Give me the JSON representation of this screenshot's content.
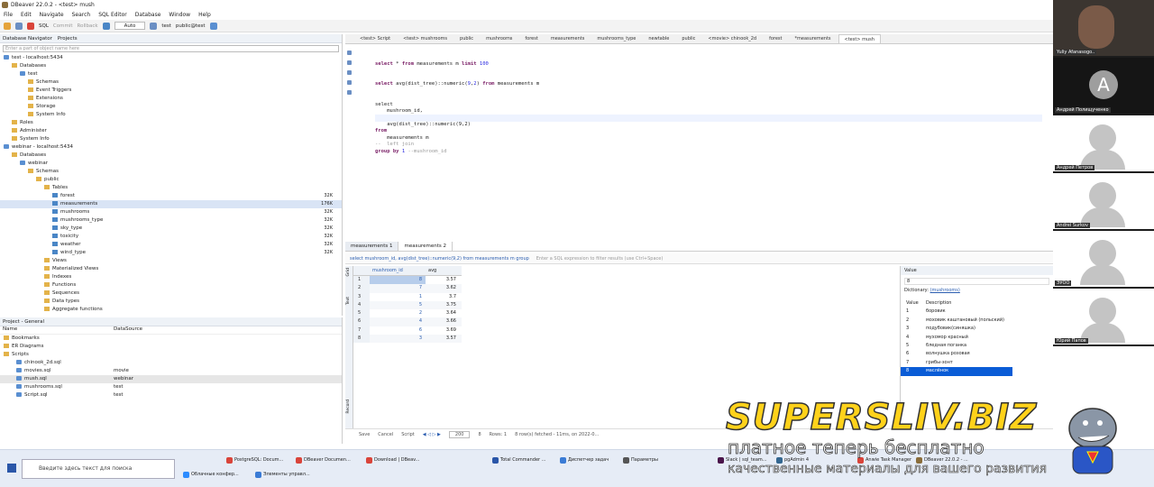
{
  "window": {
    "title": "DBeaver 22.0.2 - <test> mush"
  },
  "menu": [
    "File",
    "Edit",
    "Navigate",
    "Search",
    "SQL Editor",
    "Database",
    "Window",
    "Help"
  ],
  "toolbar": {
    "sql": "SQL",
    "commit": "Commit",
    "rollback": "Rollback",
    "mode": "Auto",
    "connection": "test",
    "schema": "public@test"
  },
  "navigator": {
    "tab1": "Database Navigator",
    "tab2": "Projects",
    "filter_placeholder": "Enter a part of object name here",
    "rows": [
      {
        "label": "test - localhost:5434",
        "indent": 0,
        "icon": "db",
        "size": ""
      },
      {
        "label": "Databases",
        "indent": 1,
        "icon": "folder",
        "size": ""
      },
      {
        "label": "test",
        "indent": 2,
        "icon": "db",
        "size": ""
      },
      {
        "label": "Schemas",
        "indent": 3,
        "icon": "folder",
        "size": ""
      },
      {
        "label": "Event Triggers",
        "indent": 3,
        "icon": "folder",
        "size": ""
      },
      {
        "label": "Extensions",
        "indent": 3,
        "icon": "folder",
        "size": ""
      },
      {
        "label": "Storage",
        "indent": 3,
        "icon": "folder",
        "size": ""
      },
      {
        "label": "System Info",
        "indent": 3,
        "icon": "folder",
        "size": ""
      },
      {
        "label": "Roles",
        "indent": 1,
        "icon": "folder",
        "size": ""
      },
      {
        "label": "Administer",
        "indent": 1,
        "icon": "folder",
        "size": ""
      },
      {
        "label": "System Info",
        "indent": 1,
        "icon": "folder",
        "size": ""
      },
      {
        "label": "webinar - localhost:5434",
        "indent": 0,
        "icon": "db",
        "size": ""
      },
      {
        "label": "Databases",
        "indent": 1,
        "icon": "folder",
        "size": ""
      },
      {
        "label": "webinar",
        "indent": 2,
        "icon": "db",
        "size": ""
      },
      {
        "label": "Schemas",
        "indent": 3,
        "icon": "folder",
        "size": ""
      },
      {
        "label": "public",
        "indent": 4,
        "icon": "folder",
        "size": ""
      },
      {
        "label": "Tables",
        "indent": 5,
        "icon": "folder",
        "size": ""
      },
      {
        "label": "forest",
        "indent": 6,
        "icon": "tbl",
        "size": "32K"
      },
      {
        "label": "measurements",
        "indent": 6,
        "icon": "tbl",
        "size": "176K",
        "selected": true
      },
      {
        "label": "mushrooms",
        "indent": 6,
        "icon": "tbl",
        "size": "32K"
      },
      {
        "label": "mushrooms_type",
        "indent": 6,
        "icon": "tbl",
        "size": "32K"
      },
      {
        "label": "sky_type",
        "indent": 6,
        "icon": "tbl",
        "size": "32K"
      },
      {
        "label": "toxicity",
        "indent": 6,
        "icon": "tbl",
        "size": "32K"
      },
      {
        "label": "weather",
        "indent": 6,
        "icon": "tbl",
        "size": "32K"
      },
      {
        "label": "wind_type",
        "indent": 6,
        "icon": "tbl",
        "size": "32K"
      },
      {
        "label": "Views",
        "indent": 5,
        "icon": "folder",
        "size": ""
      },
      {
        "label": "Materialized Views",
        "indent": 5,
        "icon": "folder",
        "size": ""
      },
      {
        "label": "Indexes",
        "indent": 5,
        "icon": "folder",
        "size": ""
      },
      {
        "label": "Functions",
        "indent": 5,
        "icon": "folder",
        "size": ""
      },
      {
        "label": "Sequences",
        "indent": 5,
        "icon": "folder",
        "size": ""
      },
      {
        "label": "Data types",
        "indent": 5,
        "icon": "folder",
        "size": ""
      },
      {
        "label": "Aggregate functions",
        "indent": 5,
        "icon": "folder",
        "size": ""
      }
    ]
  },
  "project": {
    "tab": "Project - General",
    "col_name": "Name",
    "col_ds": "DataSource",
    "rows": [
      {
        "name": "Bookmarks",
        "ds": "",
        "indent": 0
      },
      {
        "name": "ER Diagrams",
        "ds": "",
        "indent": 0
      },
      {
        "name": "Scripts",
        "ds": "",
        "indent": 0
      },
      {
        "name": "chinook_2d.sql",
        "ds": "",
        "indent": 1
      },
      {
        "name": "movies.sql",
        "ds": "movie",
        "indent": 1
      },
      {
        "name": "mush.sql",
        "ds": "webinar",
        "indent": 1,
        "selected": true
      },
      {
        "name": "mushrooms.sql",
        "ds": "test",
        "indent": 1
      },
      {
        "name": "Script.sql",
        "ds": "test",
        "indent": 1
      }
    ]
  },
  "editor_tabs": [
    "<test> Script",
    "<test> mushrooms",
    "public",
    "mushrooms",
    "forest",
    "measurements",
    "mushrooms_type",
    "newtable",
    "public",
    "<movie> chinook_2d",
    "forest",
    "*measurements",
    "<test> mush"
  ],
  "sql": {
    "l1": "select * from measurements m limit 100",
    "l2": "select avg(dist_tree)::numeric(9,2) from measurements m",
    "l3": "select",
    "l4": "    mushroom_id,",
    "l5": "    avg(dist_tree)::numeric(9,2)",
    "l6": "from",
    "l7": "    measurements m",
    "l8": "--  left join",
    "l9": "group by 1  --mushroom_id"
  },
  "results": {
    "tab1": "measurements 1",
    "tab2": "measurements 2",
    "query_text": "select mushroom_id, avg(dist_tree)::numeric(9,2) from measurements m group",
    "filter_placeholder": "Enter a SQL expression to filter results (use Ctrl+Space)",
    "columns": [
      "mushroom_id",
      "avg"
    ],
    "rows": [
      [
        "1",
        "8",
        "3.57"
      ],
      [
        "2",
        "7",
        "3.62"
      ],
      [
        "3",
        "1",
        "3.7"
      ],
      [
        "4",
        "5",
        "3.75"
      ],
      [
        "5",
        "2",
        "3.64"
      ],
      [
        "6",
        "4",
        "3.66"
      ],
      [
        "7",
        "6",
        "3.69"
      ],
      [
        "8",
        "3",
        "3.57"
      ]
    ],
    "side_labels": [
      "Grid",
      "Text",
      "Record"
    ]
  },
  "value_panel": {
    "title": "Value",
    "value": "8",
    "dictionary_label": "Dictionary:",
    "dictionary_link": "(mushrooms)",
    "col_value": "Value",
    "col_desc": "Description",
    "entries": [
      [
        "1",
        "боровик"
      ],
      [
        "2",
        "моховик каштановый (польский)"
      ],
      [
        "3",
        "подубовик(синяшка)"
      ],
      [
        "4",
        "мухомор красный"
      ],
      [
        "5",
        "бледная поганка"
      ],
      [
        "6",
        "волнушка розовая"
      ],
      [
        "7",
        "грибы-зонт"
      ],
      [
        "8",
        "маслёнок"
      ]
    ]
  },
  "status": {
    "save": "Save",
    "cancel": "Cancel",
    "script": "Script",
    "fetch_size": "200",
    "fetch_count": "8",
    "rows_label": "Rows: 1",
    "fetched": "8 row(s) fetched - 11ms, on 2022-0..."
  },
  "participants": [
    {
      "name": "Yuliy Afanasogo..",
      "type": "video"
    },
    {
      "name": "Андрей Полищученко",
      "type": "letter",
      "letter": "A"
    },
    {
      "name": "Андрей Петров",
      "type": "person"
    },
    {
      "name": "Andrei Surkov",
      "type": "person"
    },
    {
      "name": "ЭУОО",
      "type": "person"
    },
    {
      "name": "Юрий Папов",
      "type": "person"
    }
  ],
  "taskbar": {
    "search_placeholder": "Введите здесь текст для поиска",
    "apps": [
      "PostgreSQL: Docum...",
      "DBeaver Documen...",
      "Download | DBeav...",
      "Total Commander ...",
      "Диспетчер задач",
      "Параметры",
      "Slack | sql_team...",
      "pgAdmin 4",
      "Anwie Task Manager",
      "DBeaver 22.0.2 - ...",
      "Облачные конфер...",
      "Элементы управл..."
    ],
    "app_colors": [
      "#d9443a",
      "#d9443a",
      "#d9443a",
      "#2a56a8",
      "#3a7bd5",
      "#555555",
      "#4a154b",
      "#336791",
      "#d9443a",
      "#8a6d3b",
      "#2d8cff",
      "#3a7bd5"
    ]
  },
  "watermark": {
    "title": "SUPERSLIV.BIZ",
    "sub": "платное теперь бесплатно",
    "sub2": "качественные материалы для вашего развития"
  }
}
